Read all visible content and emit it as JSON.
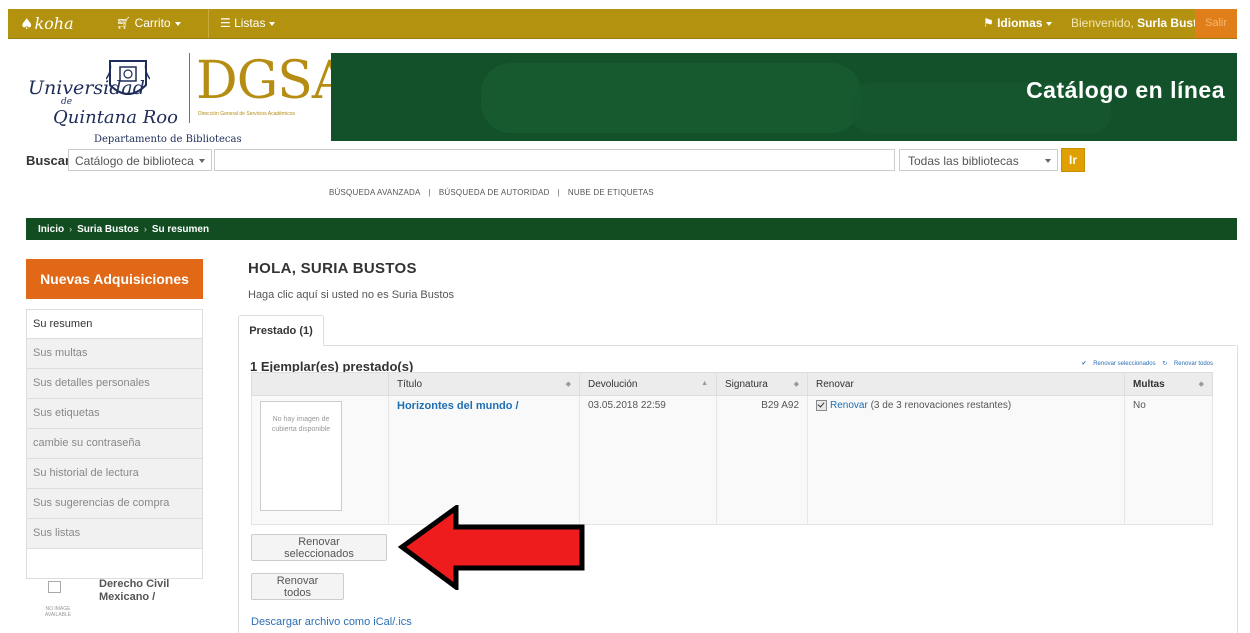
{
  "topbar": {
    "logo": "koha",
    "carrito": "Carrito",
    "listas": "Listas",
    "idiomas": "Idiomas",
    "welcome_prefix": "Bienvenido,",
    "user_name": "Surla Bustos",
    "salir": "Salir"
  },
  "header": {
    "uni_line1": "Universidad",
    "uni_de": "de",
    "uni_line2": "Quintana Roo",
    "uni_dept": "Departamento de Bibliotecas",
    "dgsa": "DGSA",
    "dgsa_sub": "Dirección General de Servicios Académicos",
    "catalog_title": "Catálogo en línea"
  },
  "search": {
    "label": "Buscar",
    "scope": "Catálogo de biblioteca",
    "query": "",
    "library": "Todas las bibliotecas",
    "go": "Ir"
  },
  "advanced_links": [
    "BÚSQUEDA AVANZADA",
    "BÚSQUEDA DE AUTORIDAD",
    "NUBE DE ETIQUETAS"
  ],
  "breadcrumb": [
    "Inicio",
    "Suria Bustos",
    "Su resumen"
  ],
  "sidebar": {
    "new_acquisitions": "Nuevas Adquisiciones",
    "items": [
      {
        "label": "Su resumen"
      },
      {
        "label": "Sus multas"
      },
      {
        "label": "Sus detalles personales"
      },
      {
        "label": "Sus etiquetas"
      },
      {
        "label": "cambie su contraseña"
      },
      {
        "label": "Su historial de lectura"
      },
      {
        "label": "Sus sugerencias de compra"
      },
      {
        "label": "Sus listas"
      }
    ],
    "new_item_title": "Derecho Civil Mexicano /",
    "no_image": "NO IMAGE AVAILABLE"
  },
  "main": {
    "greeting": "HOLA, SURIA BUSTOS",
    "not_you": "Haga clic aquí si usted no es Suria Bustos",
    "tab_label": "Prestado (1)",
    "checked_out_title": "1 Ejemplar(es) prestado(s)",
    "renew_selected_link": "Renovar seleccionados",
    "renew_all_link": "Renovar todos",
    "columns": {
      "title": "Título",
      "due": "Devolución",
      "call_number": "Signatura",
      "renew": "Renovar",
      "fines": "Multas"
    },
    "row": {
      "cover_text": "No hay imagen de cubierta disponible",
      "title": "Horizontes del mundo /",
      "due": "03.05.2018 22:59",
      "call_number": "B29 A92",
      "renew_link": "Renovar",
      "renew_note": "(3 de 3 renovaciones restantes)",
      "fines": "No"
    },
    "btn_renew_selected": "Renovar seleccionados",
    "btn_renew_all": "Renovar todos",
    "ical": "Descargar archivo como iCal/.ics"
  },
  "colors": {
    "topbar": "#b3920f",
    "banner": "#13512a",
    "orange": "#e16816",
    "arrow": "#ee1c1c"
  }
}
